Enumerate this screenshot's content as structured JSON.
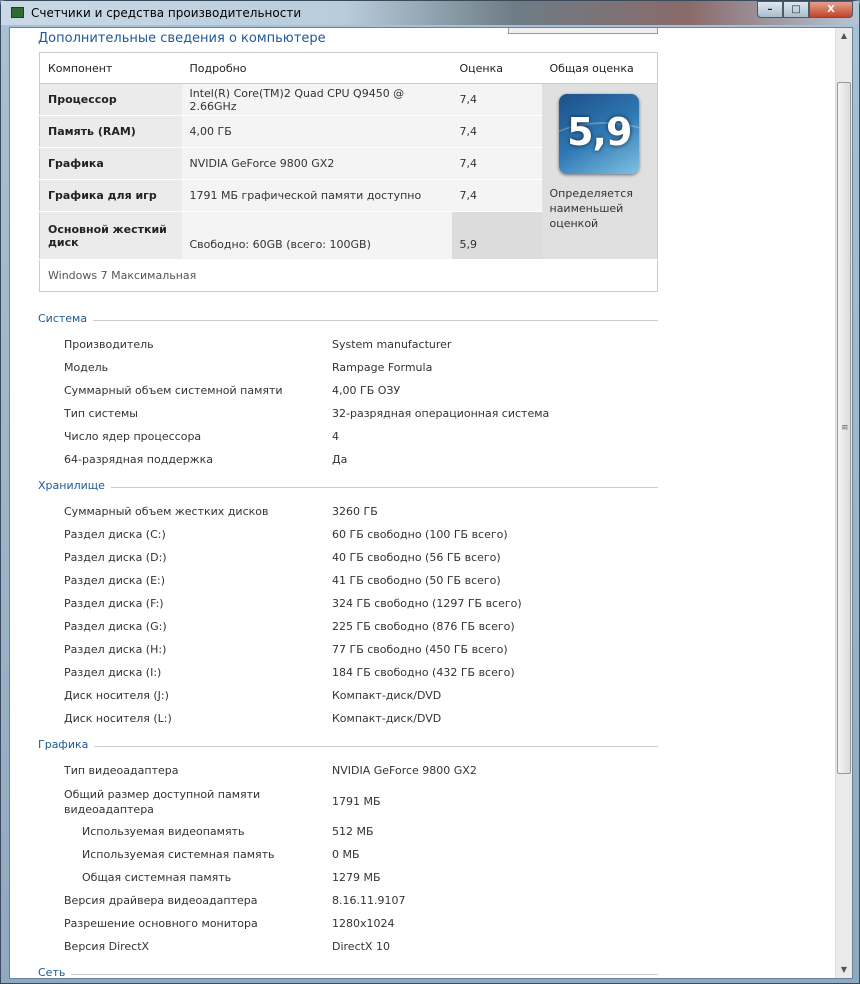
{
  "window": {
    "title": "Счетчики и средства производительности"
  },
  "page": {
    "heading": "Дополнительные сведения о компьютере"
  },
  "wei": {
    "headers": [
      "Компонент",
      "Подробно",
      "Оценка",
      "Общая оценка"
    ],
    "rows": [
      {
        "component": "Процессор",
        "details": "Intel(R) Core(TM)2 Quad CPU Q9450 @ 2.66GHz",
        "score": "7,4"
      },
      {
        "component": "Память (RAM)",
        "details": "4,00 ГБ",
        "score": "7,4"
      },
      {
        "component": "Графика",
        "details": "NVIDIA GeForce 9800 GX2",
        "score": "7,4"
      },
      {
        "component": "Графика для игр",
        "details": "1791 МБ графической памяти доступно",
        "score": "7,4"
      },
      {
        "component": "Основной жесткий диск",
        "details": "Свободно: 60GB (всего: 100GB)",
        "score": "5,9"
      }
    ],
    "base_score": "5,9",
    "base_note": "Определяется наименьшей оценкой",
    "os": "Windows 7 Максимальная"
  },
  "sections": [
    {
      "title": "Система",
      "items": [
        {
          "label": "Производитель",
          "value": "System manufacturer"
        },
        {
          "label": "Модель",
          "value": "Rampage Formula"
        },
        {
          "label": "Суммарный объем системной памяти",
          "value": "4,00 ГБ ОЗУ"
        },
        {
          "label": "Тип системы",
          "value": "32-разрядная операционная система"
        },
        {
          "label": "Число ядер процессора",
          "value": "4"
        },
        {
          "label": "64-разрядная поддержка",
          "value": "Да"
        }
      ]
    },
    {
      "title": "Хранилище",
      "items": [
        {
          "label": "Суммарный объем жестких дисков",
          "value": "3260 ГБ"
        },
        {
          "label": "Раздел диска (C:)",
          "value": "60 ГБ свободно (100 ГБ всего)"
        },
        {
          "label": "Раздел диска (D:)",
          "value": "40 ГБ свободно (56 ГБ всего)"
        },
        {
          "label": "Раздел диска (E:)",
          "value": "41 ГБ свободно (50 ГБ всего)"
        },
        {
          "label": "Раздел диска (F:)",
          "value": "324 ГБ свободно (1297 ГБ всего)"
        },
        {
          "label": "Раздел диска (G:)",
          "value": "225 ГБ свободно (876 ГБ всего)"
        },
        {
          "label": "Раздел диска (H:)",
          "value": "77 ГБ свободно (450 ГБ всего)"
        },
        {
          "label": "Раздел диска (I:)",
          "value": "184 ГБ свободно (432 ГБ всего)"
        },
        {
          "label": "Диск носителя (J:)",
          "value": "Компакт-диск/DVD"
        },
        {
          "label": "Диск носителя (L:)",
          "value": "Компакт-диск/DVD"
        }
      ]
    },
    {
      "title": "Графика",
      "items": [
        {
          "label": "Тип видеоадаптера",
          "value": "NVIDIA GeForce 9800 GX2"
        },
        {
          "label": "Общий размер доступной памяти видеоадаптера",
          "value": "1791 МБ"
        },
        {
          "label": "Используемая видеопамять",
          "value": "512 МБ"
        },
        {
          "label": "Используемая системная память",
          "value": "0 МБ"
        },
        {
          "label": "Общая системная память",
          "value": "1279 МБ"
        },
        {
          "label": "Версия драйвера видеоадаптера",
          "value": "8.16.11.9107"
        },
        {
          "label": "Разрешение основного монитора",
          "value": "1280x1024"
        },
        {
          "label": "Версия DirectX",
          "value": "DirectX 10"
        }
      ]
    },
    {
      "title": "Сеть",
      "items": []
    }
  ]
}
